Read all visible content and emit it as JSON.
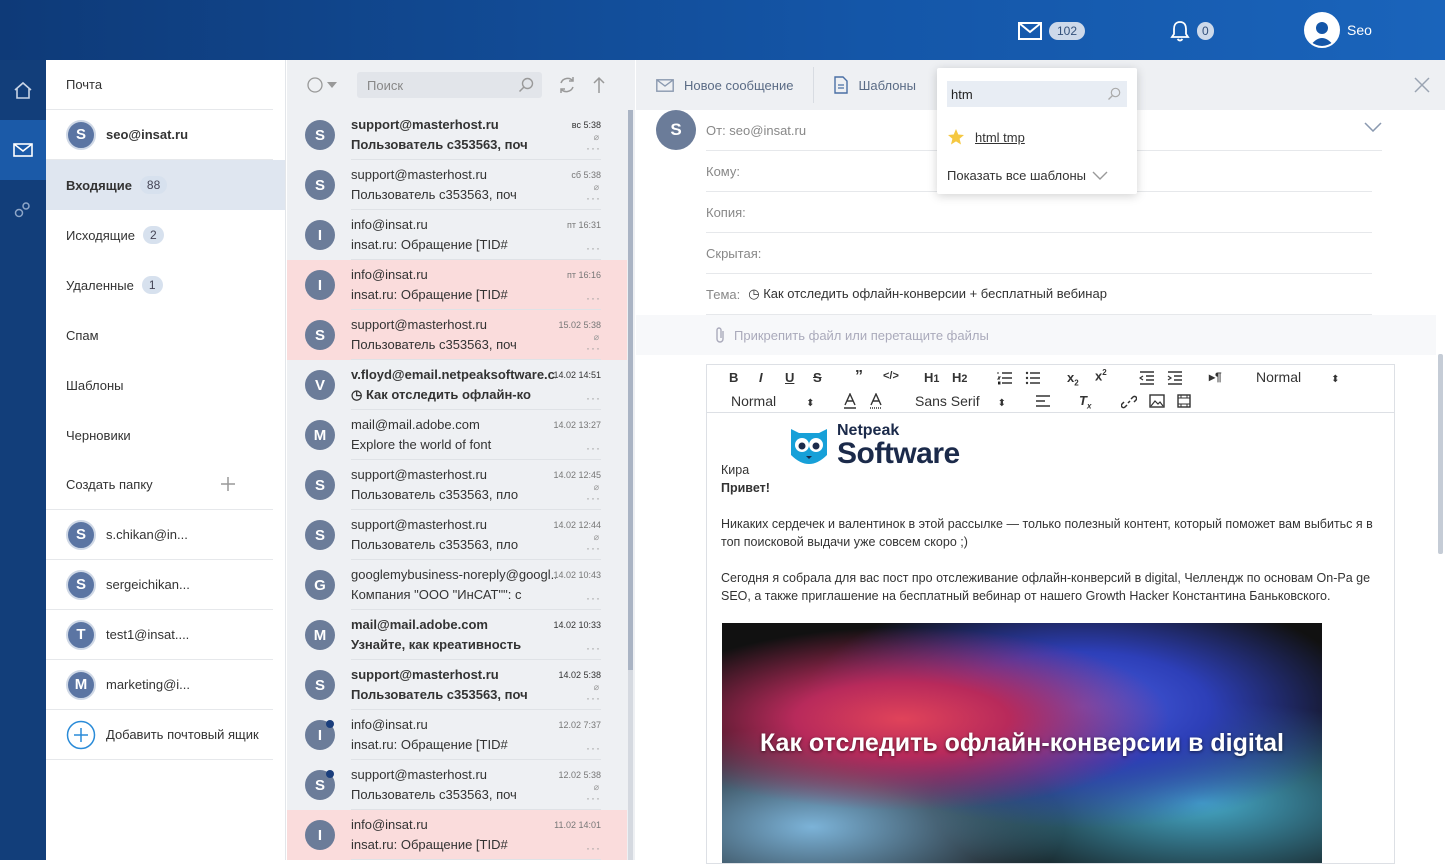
{
  "header": {
    "mail_count": "102",
    "notif_count": "0",
    "user": "Seo"
  },
  "folders": {
    "title": "Почта",
    "account": {
      "initial": "S",
      "email": "seo@insat.ru"
    },
    "items": [
      {
        "label": "Входящие",
        "count": "88"
      },
      {
        "label": "Исходящие",
        "count": "2"
      },
      {
        "label": "Удаленные",
        "count": "1"
      },
      {
        "label": "Спам"
      },
      {
        "label": "Шаблоны"
      },
      {
        "label": "Черновики"
      }
    ],
    "create_folder": "Создать папку",
    "accounts": [
      {
        "initial": "S",
        "label": "s.chikan@in..."
      },
      {
        "initial": "S",
        "label": "sergeichikan..."
      },
      {
        "initial": "T",
        "label": "test1@insat...."
      },
      {
        "initial": "M",
        "label": "marketing@i..."
      }
    ],
    "add_mailbox": "Добавить почтовый ящик"
  },
  "mail_list": {
    "search_placeholder": "Поиск",
    "messages": [
      {
        "initial": "S",
        "from": "support@masterhost.ru",
        "subject": "Пользователь c353563, поч",
        "date": "вс 5:38",
        "unread": true,
        "pink": false,
        "clip": true
      },
      {
        "initial": "S",
        "from": "support@masterhost.ru",
        "subject": "Пользователь c353563, поч",
        "date": "сб 5:38",
        "unread": false,
        "pink": false,
        "clip": true
      },
      {
        "initial": "I",
        "from": "info@insat.ru",
        "subject": "insat.ru: Обращение [TID#",
        "date": "пт 16:31",
        "unread": false,
        "pink": false,
        "clip": false
      },
      {
        "initial": "I",
        "from": "info@insat.ru",
        "subject": "insat.ru: Обращение [TID#",
        "date": "пт 16:16",
        "unread": false,
        "pink": true,
        "clip": false
      },
      {
        "initial": "S",
        "from": "support@masterhost.ru",
        "subject": "Пользователь c353563, поч",
        "date": "15.02 5:38",
        "unread": false,
        "pink": true,
        "clip": true
      },
      {
        "initial": "V",
        "from": "v.floyd@email.netpeaksoftware.c...",
        "subject": "◷ Как отследить офлайн-ко",
        "date": "14.02 14:51",
        "unread": true,
        "pink": false,
        "clip": false
      },
      {
        "initial": "M",
        "from": "mail@mail.adobe.com",
        "subject": "Explore the world of font",
        "date": "14.02 13:27",
        "unread": false,
        "pink": false,
        "clip": false
      },
      {
        "initial": "S",
        "from": "support@masterhost.ru",
        "subject": "Пользователь c353563, пло",
        "date": "14.02 12:45",
        "unread": false,
        "pink": false,
        "clip": true
      },
      {
        "initial": "S",
        "from": "support@masterhost.ru",
        "subject": "Пользователь c353563, пло",
        "date": "14.02 12:44",
        "unread": false,
        "pink": false,
        "clip": true
      },
      {
        "initial": "G",
        "from": "googlemybusiness-noreply@googl...",
        "subject": "Компания \"ООО \"ИнСАТ\"\": с",
        "date": "14.02 10:43",
        "unread": false,
        "pink": false,
        "clip": false
      },
      {
        "initial": "M",
        "from": "mail@mail.adobe.com",
        "subject": "Узнайте, как креативность",
        "date": "14.02 10:33",
        "unread": true,
        "pink": false,
        "clip": false
      },
      {
        "initial": "S",
        "from": "support@masterhost.ru",
        "subject": "Пользователь c353563, поч",
        "date": "14.02 5:38",
        "unread": true,
        "pink": false,
        "clip": true
      },
      {
        "initial": "I",
        "from": "info@insat.ru",
        "subject": "insat.ru: Обращение [TID#",
        "date": "12.02 7:37",
        "unread": false,
        "pink": false,
        "clip": false,
        "mark": true
      },
      {
        "initial": "S",
        "from": "support@masterhost.ru",
        "subject": "Пользователь c353563, поч",
        "date": "12.02 5:38",
        "unread": false,
        "pink": false,
        "clip": true,
        "mark": true
      },
      {
        "initial": "I",
        "from": "info@insat.ru",
        "subject": "insat.ru: Обращение [TID#",
        "date": "11.02 14:01",
        "unread": false,
        "pink": true,
        "clip": false
      }
    ]
  },
  "compose": {
    "new_message": "Новое сообщение",
    "templates": "Шаблоны",
    "from_initial": "S",
    "from": "От: seo@insat.ru",
    "to_label": "Кому:",
    "cc_label": "Копия:",
    "bcc_label": "Скрытая:",
    "subject_label": "Тема:",
    "subject_value": "◷ Как отследить офлайн-конверсии + бесплатный вебинар",
    "attach": "Прикрепить файл или перетащите файлы",
    "toolbar": {
      "heading_select": "Normal",
      "size_select": "Normal",
      "font_select": "Sans Serif",
      "h1": "H",
      "h2": "H"
    },
    "body": {
      "logo_top": "Netpeak",
      "logo_bottom": "Software",
      "name": "Кира",
      "greeting": "Привет!",
      "p1": "Никаких сердечек и валентинок в этой рассылке — только полезный контент, который поможет вам выбитьс я в топ поисковой выдачи уже совсем скоро ;)",
      "p2": "Сегодня я собрала для вас пост про отслеживание офлайн-конверсий в digital, Челлендж по основам On-Pa ge SEO, а также приглашение на бесплатный вебинар от нашего Growth Hacker Константина Баньковского.",
      "banner_text": "Как отследить офлайн-конверсии в digital"
    }
  },
  "templates_dropdown": {
    "query": "htm",
    "item": "html tmp",
    "show_all": "Показать все шаблоны"
  }
}
